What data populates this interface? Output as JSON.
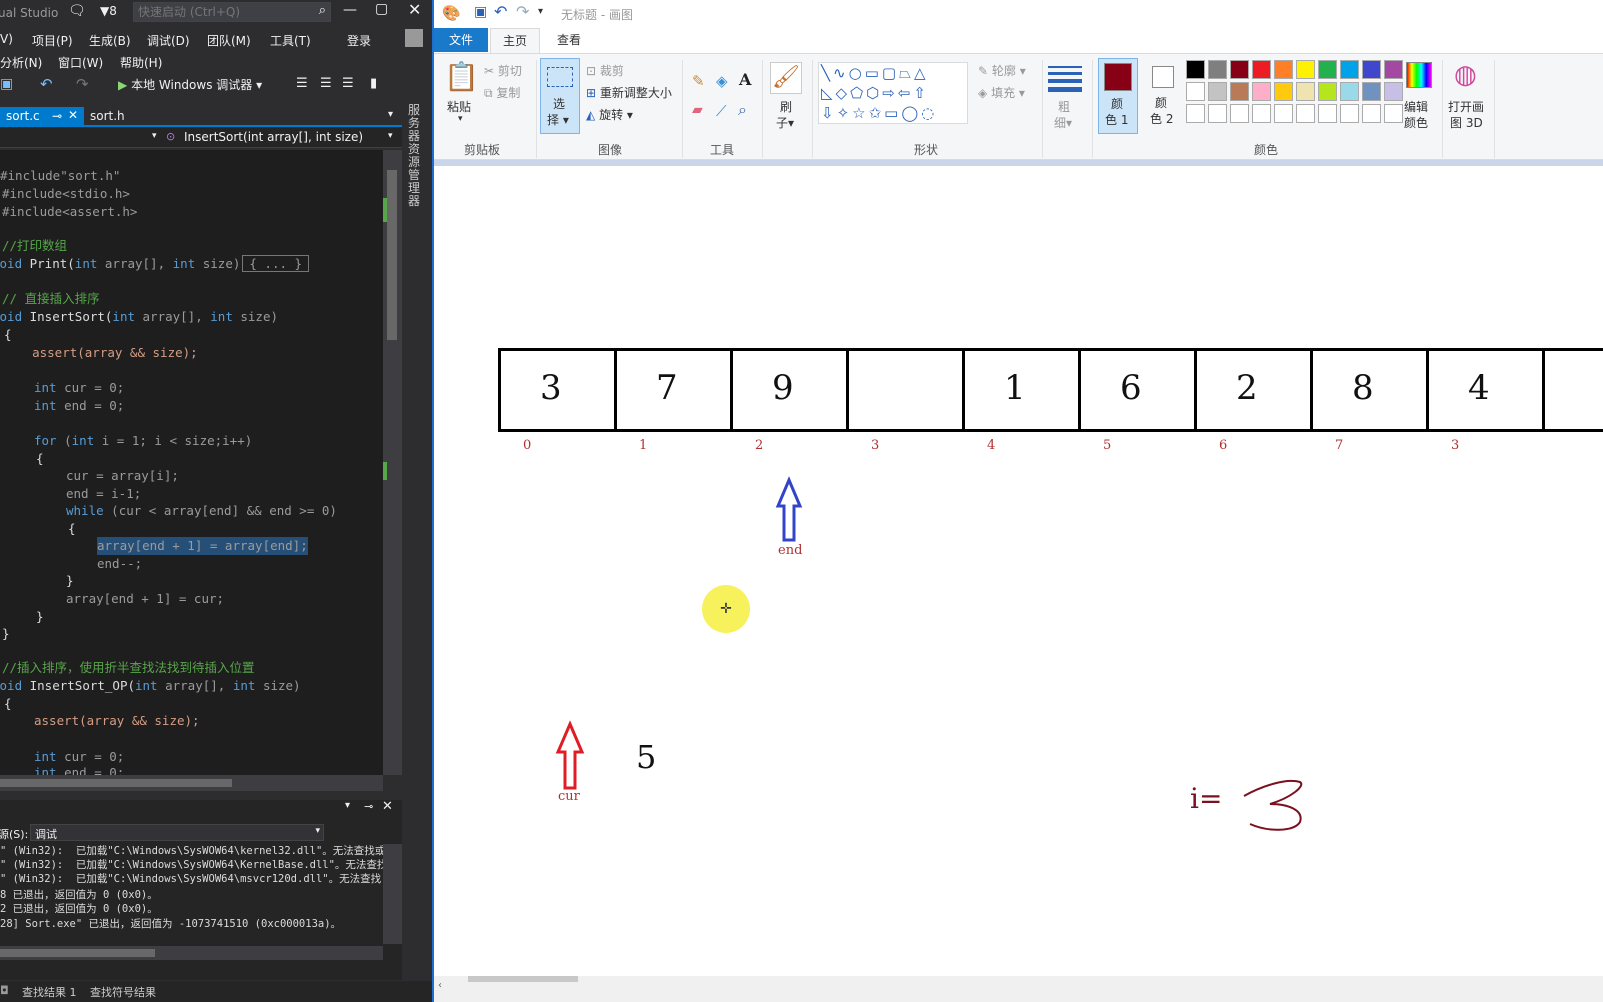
{
  "vs": {
    "title": "ual Studio",
    "notification_count": "8",
    "quick_launch_placeholder": "快速启动 (Ctrl+Q)",
    "menu_row1": [
      "V)",
      "项目(P)",
      "生成(B)",
      "调试(D)",
      "团队(M)",
      "工具(T)",
      "登录"
    ],
    "menu_row2": [
      "分析(N)",
      "窗口(W)",
      "帮助(H)"
    ],
    "debug_button": "本地 Windows 调试器",
    "tabs": [
      {
        "label": "sort.c",
        "active": true
      },
      {
        "label": "sort.h",
        "active": false
      }
    ],
    "nav_function": "InsertSort(int array[], int size)",
    "side_tab": "服务器资源管理器",
    "code": {
      "l1": "#include\"sort.h\"",
      "l2": "#include<stdio.h>",
      "l3": "#include<assert.h>",
      "l4": "//打印数组",
      "l5a": "void",
      "l5b": " Print(",
      "l5c": "int",
      "l5d": " array[], ",
      "l5e": "int",
      "l5f": " size)",
      "l5g": "{ ... }",
      "l6": "// 直接插入排序",
      "l7a": "void",
      "l7b": " InsertSort(",
      "l7c": "int",
      "l7d": " array[], ",
      "l7e": "int",
      "l7f": " size)",
      "l8": "{",
      "l9": "    assert(array && size);",
      "l10a": "int",
      "l10b": " cur = 0;",
      "l11a": "int",
      "l11b": " end = 0;",
      "l12a": "for",
      "l12b": " (",
      "l12c": "int",
      "l12d": " i = 1; i < size;i++)",
      "l13": "{",
      "l14": "cur = array[i];",
      "l15": "end = i-1;",
      "l16a": "while",
      "l16b": " (cur < array[end] && end >= 0)",
      "l17": "{",
      "l18": "array[end + 1] = array[end];",
      "l19": "end--;",
      "l20": "}",
      "l21": "array[end + 1] = cur;",
      "l22": "}",
      "l23": "}",
      "l24": "//插入排序，使用折半查找法找到待插入位置",
      "l25a": "void",
      "l25b": " InsertSort_OP(",
      "l25c": "int",
      "l25d": " array[], ",
      "l25e": "int",
      "l25f": " size)",
      "l26": "{",
      "l27": "assert(array && size);",
      "l28a": "int",
      "l28b": " cur = 0;",
      "l29a": "int",
      "l29b": " end = 0;"
    },
    "output": {
      "source_label": "源(S):",
      "source_value": "调试",
      "lines": [
        "\" (Win32):  已加载\"C:\\Windows\\SysWOW64\\kernel32.dll\"。无法查找或",
        "\" (Win32):  已加载\"C:\\Windows\\SysWOW64\\KernelBase.dll\"。无法查找",
        "\" (Win32):  已加载\"C:\\Windows\\SysWOW64\\msvcr120d.dll\"。无法查找",
        "8 已退出，返回值为 0 (0x0)。",
        "2 已退出，返回值为 0 (0x0)。",
        "28] Sort.exe\" 已退出，返回值为 -1073741510 (0xc000013a)。"
      ]
    },
    "bottom_tabs": [
      "查找结果 1",
      "查找符号结果"
    ]
  },
  "paint": {
    "title": "无标题 - 画图",
    "tabs": [
      "文件",
      "主页",
      "查看"
    ],
    "ribbon": {
      "paste": "粘贴",
      "cut": "剪切",
      "copy": "复制",
      "clipboard_group": "剪贴板",
      "select_1": "选",
      "select_2": "择",
      "crop": "裁剪",
      "resize": "重新调整大小",
      "rotate": "旋转",
      "image_group": "图像",
      "tools_group": "工具",
      "brush_1": "刷",
      "brush_2": "子",
      "shapes_group": "形状",
      "outline": "轮廓",
      "fill": "填充",
      "size_1": "粗",
      "size_2": "细",
      "color1_1": "颜",
      "color1_2": "色 1",
      "color2_1": "颜",
      "color2_2": "色 2",
      "colors_group": "颜色",
      "edit_colors_1": "编辑",
      "edit_colors_2": "颜色",
      "paint3d_1": "打开画",
      "paint3d_2": "图 3D"
    },
    "colors": {
      "color1": "#880015",
      "color2": "#ffffff",
      "palette_row1": [
        "#000000",
        "#7f7f7f",
        "#880015",
        "#ed1c24",
        "#ff7f27",
        "#fff200",
        "#22b14c",
        "#00a2e8",
        "#3f48cc",
        "#a349a4"
      ],
      "palette_row2": [
        "#ffffff",
        "#c3c3c3",
        "#b97a57",
        "#ffaec9",
        "#ffc90e",
        "#efe4b0",
        "#b5e61d",
        "#99d9ea",
        "#7092be",
        "#c8bfe7"
      ]
    },
    "drawing": {
      "cells": [
        "3",
        "7",
        "9",
        "",
        "1",
        "6",
        "2",
        "8",
        "4",
        ""
      ],
      "indices": [
        "0",
        "1",
        "2",
        "3",
        "4",
        "5",
        "6",
        "7",
        "3"
      ],
      "end_label": "end",
      "cur_label": "cur",
      "cur_value": "5",
      "i_label": "i="
    }
  }
}
